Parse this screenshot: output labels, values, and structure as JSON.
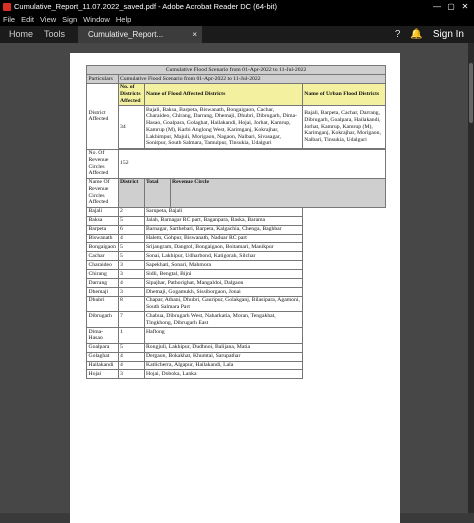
{
  "window": {
    "title": "Cumulative_Report_11.07.2022_saved.pdf - Adobe Acrobat Reader DC (64-bit)",
    "min": "—",
    "max": "▢",
    "close": "✕"
  },
  "menu": [
    "File",
    "Edit",
    "View",
    "Sign",
    "Window",
    "Help"
  ],
  "toolbar": {
    "home": "Home",
    "tools": "Tools",
    "doc_tab": "Cumulative_Report...",
    "doc_close": "×",
    "help_icon": "?",
    "bell_icon": "🔔",
    "sign_in": "Sign In"
  },
  "report": {
    "title": "Cumulative Flood Scenario from 01-Apr-2022 to 11-Jul-2022",
    "particulars_label": "Particulars",
    "particulars_value": "Cumulative Flood Scenario from 01-Apr-2022 to 11-Jul-2022",
    "hdr_no_districts": "No. of Districts Affected",
    "hdr_flood_districts": "Name of Flood Affected Districts",
    "hdr_urban": "Name of Urban Flood Districts",
    "district_affected_label": "District Affected",
    "district_count": "34",
    "flood_districts": "Bajali, Baksa, Barpeta, Biswanath, Bongaigaon, Cachar, Charaideo, Chirang, Darrang, Dhemaji, Dhubri, Dibrugarh, Dima-Hasao, Goalpara, Golaghat, Hailakandi, Hojai, Jorhat, Kamrup, Kamrup (M), Karbi Anglong West, Karimganj, Kokrajhar, Lakhimpur, Majuli, Morigaon, Nagaon, Nalbari, Sivasagar, Sonitpur, South Salmara, Tamulpur, Tinsukia, Udalguri",
    "urban_districts": "Bajali, Barpeta, Cachar, Darrang, Dibrugarh, Goalpara, Hailakandi, Jorhat, Kamrup, Kamrup (M), Karimganj, Kokrajhar, Morigaon, Nalbari, Tinsukia, Udalguri",
    "revenue_circles_label": "No. Of Revenue Circles Affected",
    "revenue_circles_count": "152",
    "rc_names_label": "Name Of Revenue Circles Affected",
    "rc_headers": [
      "District",
      "Total",
      "Revenue Circle"
    ],
    "rc_rows": [
      {
        "district": "Bajali",
        "total": "2",
        "circles": "Sarupeta, Bajali"
      },
      {
        "district": "Baksa",
        "total": "5",
        "circles": "Jalah, Barnagar RC part, Baganpara, Baska, Barama"
      },
      {
        "district": "Barpeta",
        "total": "6",
        "circles": "Barnagar, Sarthebari, Barpeta, Kalgachia, Chenga, Baghbar"
      },
      {
        "district": "Biswanath",
        "total": "4",
        "circles": "Halem, Gohpur, Biswanath, Naduar RC part"
      },
      {
        "district": "Bongaigaon",
        "total": "5",
        "circles": "Srijangram, Dangtol, Bongaigaon, Boitamari, Manikpur"
      },
      {
        "district": "Cachar",
        "total": "5",
        "circles": "Sonai, Lakhipur, Udharbond, Katigorah, Silchar"
      },
      {
        "district": "Charaideo",
        "total": "3",
        "circles": "Sapekhati, Sonari, Mahmora"
      },
      {
        "district": "Chirang",
        "total": "3",
        "circles": "Sidli, Bengtal, Bijni"
      },
      {
        "district": "Darrang",
        "total": "4",
        "circles": "Sipajhar, Pathorighat, Mangaldoi, Dalgaon"
      },
      {
        "district": "Dhemaji",
        "total": "3",
        "circles": "Dhemaji, Gogamukh, Sissiborgaon, Jonai"
      },
      {
        "district": "Dhubri",
        "total": "8",
        "circles": "Chapar, Athani, Dhubri, Gauripur, Golakganj, Bilasipara, Agamoni, South Salmara Part"
      },
      {
        "district": "Dibrugarh",
        "total": "7",
        "circles": "Chabua, Dibrugarh West, Naharkatia, Moran, Tengakhat, Tingkhong, Dibrugarh East"
      },
      {
        "district": "Dima-Hasao",
        "total": "1",
        "circles": "Haflong"
      },
      {
        "district": "Goalpara",
        "total": "5",
        "circles": "Rongjuli, Lakhipur, Dudhnoi, Balijana, Matia"
      },
      {
        "district": "Golaghat",
        "total": "4",
        "circles": "Dergaon, Bokakhat, Khumtai, Sarupathar"
      },
      {
        "district": "Hailakandi",
        "total": "4",
        "circles": "Katlicherra, Algapur, Hailakandi, Lala"
      },
      {
        "district": "Hojai",
        "total": "3",
        "circles": "Hojai, Doboka, Lanka"
      }
    ]
  }
}
